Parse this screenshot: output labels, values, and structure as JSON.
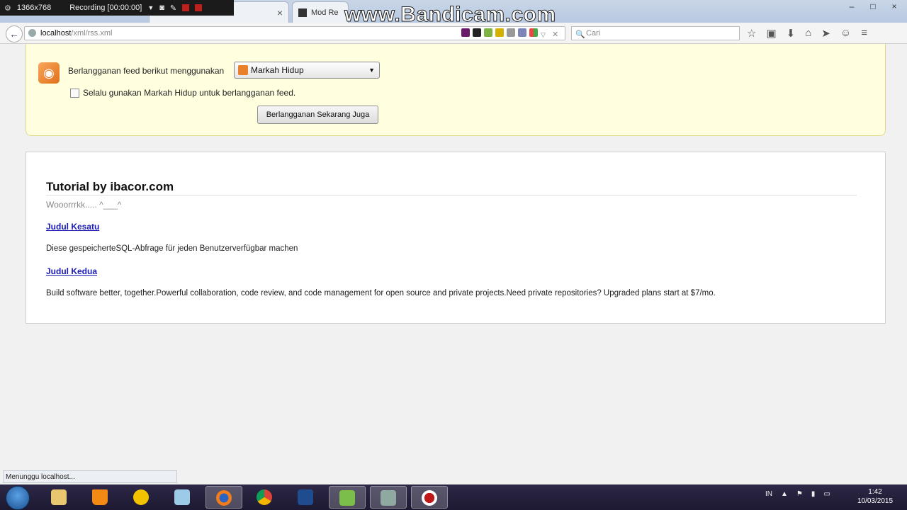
{
  "recorder": {
    "resolution": "1366x768",
    "status": "Recording [00:00:00]",
    "watermark": "www.Bandicam.com"
  },
  "tabs": [
    {
      "label": "Mod Re",
      "close": "×"
    }
  ],
  "browser": {
    "back": "←",
    "url_host": "localhost",
    "url_path": "/xml/rss.xml",
    "search_placeholder": "Cari",
    "search_glyph": "🔍",
    "toolbar_glyphs": [
      "☆",
      "▣",
      "⬇",
      "⌂",
      "➤",
      "☺",
      "≡"
    ],
    "window_controls": [
      "–",
      "□",
      "×"
    ]
  },
  "subscribe": {
    "label": "Berlangganan feed berikut menggunakan",
    "reader": "Markah Hidup",
    "caret": "▼",
    "always_label": "Selalu gunakan Markah Hidup untuk berlangganan feed.",
    "button": "Berlangganan Sekarang Juga"
  },
  "feed": {
    "title": "Tutorial by ibacor.com",
    "subtitle": "Wooorrrkk..... ^___^",
    "items": [
      {
        "title": "Judul Kesatu",
        "description": "Diese gespeicherteSQL-Abfrage für jeden Benutzerverfügbar machen"
      },
      {
        "title": "Judul Kedua",
        "description": "Build software better, together.Powerful collaboration, code review, and code management for open source and private projects.Need private repositories? Upgraded plans start at $7/mo."
      }
    ]
  },
  "status_bar": "Menunggu localhost...",
  "taskbar": {
    "tray_lang": "IN",
    "time": "1:42",
    "date": "10/03/2015"
  },
  "colors": {
    "subscribe_bg": "#ffffe0",
    "link": "#1a1ab4",
    "rss": "#e8812a"
  }
}
